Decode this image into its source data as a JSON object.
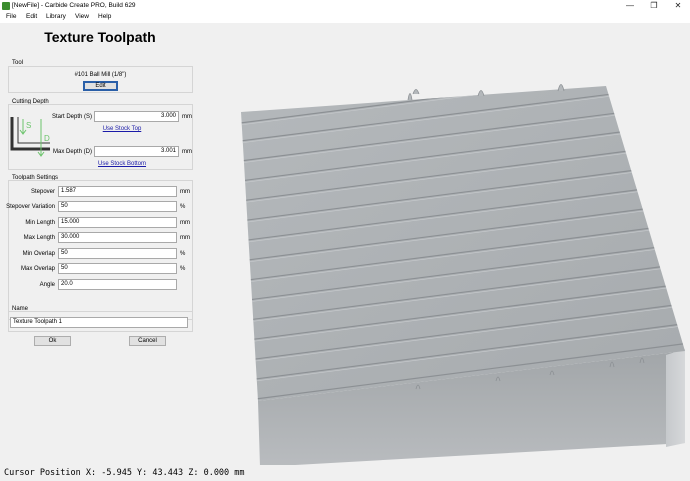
{
  "window": {
    "title": "[NewFile] - Carbide Create PRO, Build 629"
  },
  "menu": [
    "File",
    "Edit",
    "Library",
    "View",
    "Help"
  ],
  "panel": {
    "heading": "Texture Toolpath",
    "tool": {
      "label": "Tool",
      "name": "#101 Ball Mill (1/8\")",
      "edit": "Edit"
    },
    "cutting_depth": {
      "label": "Cutting Depth",
      "start_label": "Start Depth (S)",
      "start_value": "3.000",
      "start_unit": "mm",
      "use_top": "Use Stock Top",
      "max_label": "Max Depth (D)",
      "max_value": "3.001",
      "max_unit": "mm",
      "use_bottom": "Use Stock Bottom",
      "diagram_s": "S",
      "diagram_d": "D"
    },
    "settings": {
      "label": "Toolpath Settings",
      "rows": [
        {
          "label": "Stepover",
          "value": "1.587",
          "unit": "mm"
        },
        {
          "label": "Stepover Variation",
          "value": "50",
          "unit": "%"
        },
        {
          "label": "Min Length",
          "value": "15.000",
          "unit": "mm"
        },
        {
          "label": "Max Length",
          "value": "30.000",
          "unit": "mm"
        },
        {
          "label": "Min Overlap",
          "value": "50",
          "unit": "%"
        },
        {
          "label": "Max Overlap",
          "value": "50",
          "unit": "%"
        },
        {
          "label": "Angle",
          "value": "20.0",
          "unit": ""
        }
      ]
    },
    "name": {
      "label": "Name",
      "value": "Texture Toolpath 1"
    },
    "ok": "Ok",
    "cancel": "Cancel"
  },
  "status": {
    "text": "Cursor Position X: -5.945 Y: 43.443 Z: 0.000 mm"
  },
  "colors": {
    "accent": "#2a5fa8",
    "link": "#1a1aa8",
    "diagram": "#6cc46c"
  }
}
